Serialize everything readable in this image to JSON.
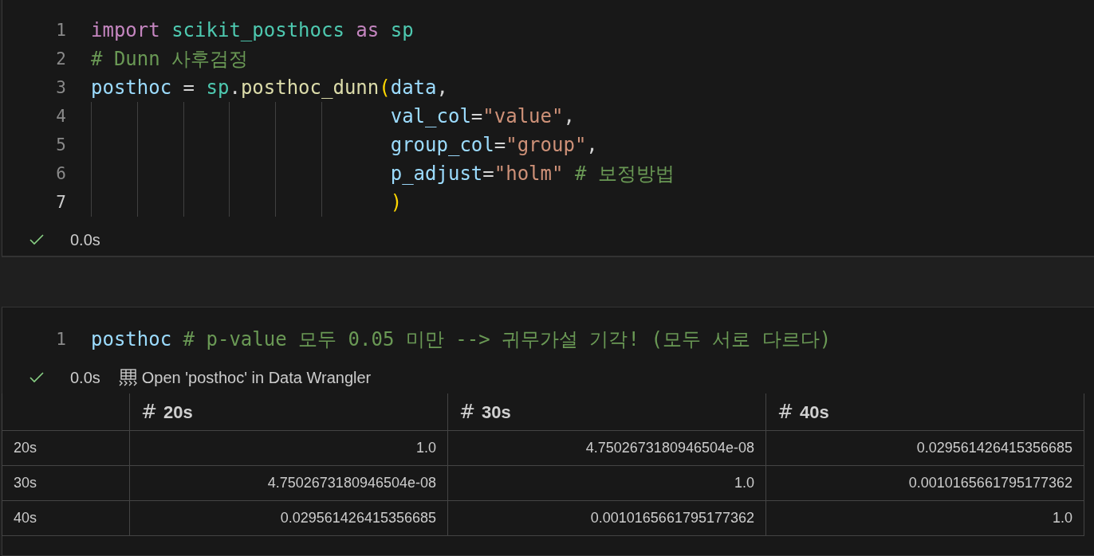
{
  "cells": [
    {
      "lines": [
        {
          "number": "1",
          "active": false,
          "tokens": [
            {
              "kind": "keyword",
              "text": "import"
            },
            {
              "kind": "module",
              "text": " scikit_posthocs"
            },
            {
              "kind": "keyword",
              "text": " as"
            },
            {
              "kind": "module",
              "text": " sp"
            }
          ]
        },
        {
          "number": "2",
          "active": false,
          "tokens": [
            {
              "kind": "comment",
              "text": "# Dunn 사후검정"
            }
          ]
        },
        {
          "number": "3",
          "active": false,
          "tokens": [
            {
              "kind": "variable",
              "text": "posthoc"
            },
            {
              "kind": "plain",
              "text": " = "
            },
            {
              "kind": "module",
              "text": "sp"
            },
            {
              "kind": "plain",
              "text": "."
            },
            {
              "kind": "function",
              "text": "posthoc_dunn"
            },
            {
              "kind": "bracket",
              "text": "("
            },
            {
              "kind": "variable",
              "text": "data"
            },
            {
              "kind": "plain",
              "text": ","
            }
          ]
        },
        {
          "number": "4",
          "active": false,
          "continuation": true,
          "tokens": [
            {
              "kind": "variable",
              "text": "val_col"
            },
            {
              "kind": "plain",
              "text": "="
            },
            {
              "kind": "string",
              "text": "\"value\""
            },
            {
              "kind": "plain",
              "text": ","
            }
          ]
        },
        {
          "number": "5",
          "active": false,
          "continuation": true,
          "tokens": [
            {
              "kind": "variable",
              "text": "group_col"
            },
            {
              "kind": "plain",
              "text": "="
            },
            {
              "kind": "string",
              "text": "\"group\""
            },
            {
              "kind": "plain",
              "text": ","
            }
          ]
        },
        {
          "number": "6",
          "active": false,
          "continuation": true,
          "tokens": [
            {
              "kind": "variable",
              "text": "p_adjust"
            },
            {
              "kind": "plain",
              "text": "="
            },
            {
              "kind": "string",
              "text": "\"holm\""
            },
            {
              "kind": "comment",
              "text": " # 보정방법"
            }
          ]
        },
        {
          "number": "7",
          "active": true,
          "continuation": true,
          "tokens": [
            {
              "kind": "bracket",
              "text": ")"
            }
          ]
        }
      ],
      "status": {
        "success": true,
        "time": "0.0s"
      }
    },
    {
      "lines": [
        {
          "number": "1",
          "active": false,
          "tokens": [
            {
              "kind": "variable",
              "text": "posthoc"
            },
            {
              "kind": "comment",
              "text": " # p-value 모두 0.05 미만 --> 귀무가설 기각! (모두 서로 다르다)"
            }
          ]
        }
      ],
      "status": {
        "success": true,
        "time": "0.0s",
        "action": "Open 'posthoc' in Data Wrangler"
      },
      "table": {
        "columns": [
          {
            "type_mark": "#",
            "label": "20s"
          },
          {
            "type_mark": "#",
            "label": "30s"
          },
          {
            "type_mark": "#",
            "label": "40s"
          }
        ],
        "rows": [
          {
            "index": "20s",
            "values": [
              "1.0",
              "4.7502673180946504e-08",
              "0.029561426415356685"
            ]
          },
          {
            "index": "30s",
            "values": [
              "4.7502673180946504e-08",
              "1.0",
              "0.0010165661795177362"
            ]
          },
          {
            "index": "40s",
            "values": [
              "0.029561426415356685",
              "0.0010165661795177362",
              "1.0"
            ]
          }
        ]
      }
    }
  ]
}
